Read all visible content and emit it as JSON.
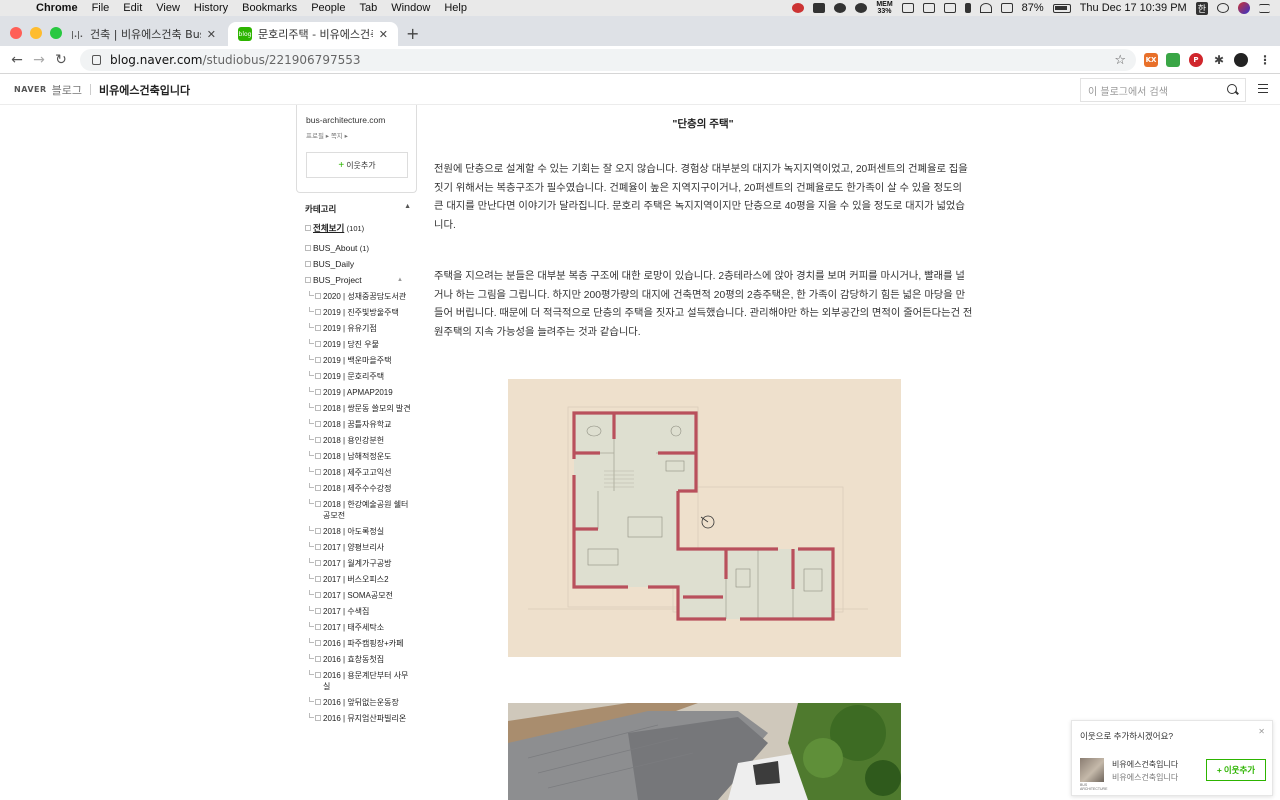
{
  "menubar": {
    "app": "Chrome",
    "items": [
      "File",
      "Edit",
      "View",
      "History",
      "Bookmarks",
      "People",
      "Tab",
      "Window",
      "Help"
    ],
    "mem_label": "MEM",
    "mem_value": "33%",
    "battery": "87%",
    "clock": "Thu Dec 17  10:39 PM",
    "input_method": "한"
  },
  "tabs": [
    {
      "title": "건축 | 비유에스건축 Bus Architect",
      "favicon": "bus-logo-icon"
    },
    {
      "title": "문호리주택 - 비유에스건축 / 신축설계",
      "favicon": "naver-blog-icon"
    }
  ],
  "toolbar": {
    "url_host": "blog.naver.com",
    "url_path": "/studiobus/221906797553"
  },
  "blog_header": {
    "naver": "NAVER",
    "blog_word": "블로그",
    "blog_name": "비유에스건축입니다",
    "search_placeholder": "이 블로그에서 검색"
  },
  "sidebar": {
    "site_url": "bus-architecture.com",
    "profile_links": "프로필 ▸ 쪽지 ▸",
    "add_neighbor": "이웃추가",
    "categories_title": "카테고리",
    "all_label": "전체보기",
    "all_count": "(101)",
    "top_categories": [
      {
        "name": "BUS_About",
        "count": "(1)"
      },
      {
        "name": "BUS_Daily",
        "count": ""
      },
      {
        "name": "BUS_Project",
        "count": ""
      }
    ],
    "sub_categories": [
      "2020 | 성재중꿈담도서관",
      "2019 | 진주빛방울주택",
      "2019 | 유유기점",
      "2019 | 당진 우물",
      "2019 | 백운마을주택",
      "2019 | 문호리주택",
      "2019 | APMAP2019",
      "2018 | 쌍문동 쓸모의 발견",
      "2018 | 꿈틀자유학교",
      "2018 | 용인강분헌",
      "2018 | 남해적정운도",
      "2018 | 제주고고익선",
      "2018 | 제주수수강정",
      "2018 | 한강예술공원 쉘터공모전",
      "2018 | 아도록정실",
      "2017 | 양평브리사",
      "2017 | 월계가구공방",
      "2017 | 버스오피스2",
      "2017 | SOMA공모전",
      "2017 | 수색집",
      "2017 | 태주세탁소",
      "2016 | 파주캠핑장+카페",
      "2016 | 효창동첫집",
      "2016 | 용문계단부터 사무실",
      "2016 | 앞뒤없는운동장",
      "2016 | 뮤지엄산파빌리온"
    ]
  },
  "post": {
    "heading": "\"단층의 주택\"",
    "paragraph1": "전원에 단층으로 설계할 수 있는 기회는 잘 오지 않습니다. 경험상 대부분의 대지가 녹지지역이었고, 20퍼센트의 건폐율로 집을 짓기 위해서는 복층구조가 필수였습니다. 건폐율이 높은 지역지구이거나, 20퍼센트의 건폐율로도 한가족이 살 수 있을 정도의 큰 대지를 만난다면 이야기가 달라집니다. 문호리 주택은 녹지지역이지만 단층으로 40평을 지을 수 있을 정도로 대지가 넓었습니다.",
    "paragraph2": "주택을 지으려는 분들은 대부분 복층 구조에 대한 로망이 있습니다. 2층테라스에 앉아 경치를 보며 커피를 마시거나, 빨래를 널거나 하는 그림을 그립니다. 하지만 200평가량의 대지에 건축면적 20평의 2층주택은, 한 가족이 감당하기 힘든 넓은 마당을 만들어 버립니다. 때문에 더 적극적으로 단층의 주택을 짓자고 설득했습니다. 관리해야만 하는 외부공간의 면적이 줄어든다는건 전원주택의 지속 가능성을 늘려주는 것과 같습니다."
  },
  "popup": {
    "question": "이웃으로 추가하시겠어요?",
    "name1": "비유에스건축입니다",
    "name2": "비유에스건축입니다",
    "thumb_caption": "BUS ARCHITECTURE",
    "button": "이웃추가"
  },
  "colors": {
    "naver_green": "#2db400",
    "plan_background": "#eee0cc",
    "plan_walls": "#b9505c",
    "plan_floor": "#dedfd0"
  }
}
